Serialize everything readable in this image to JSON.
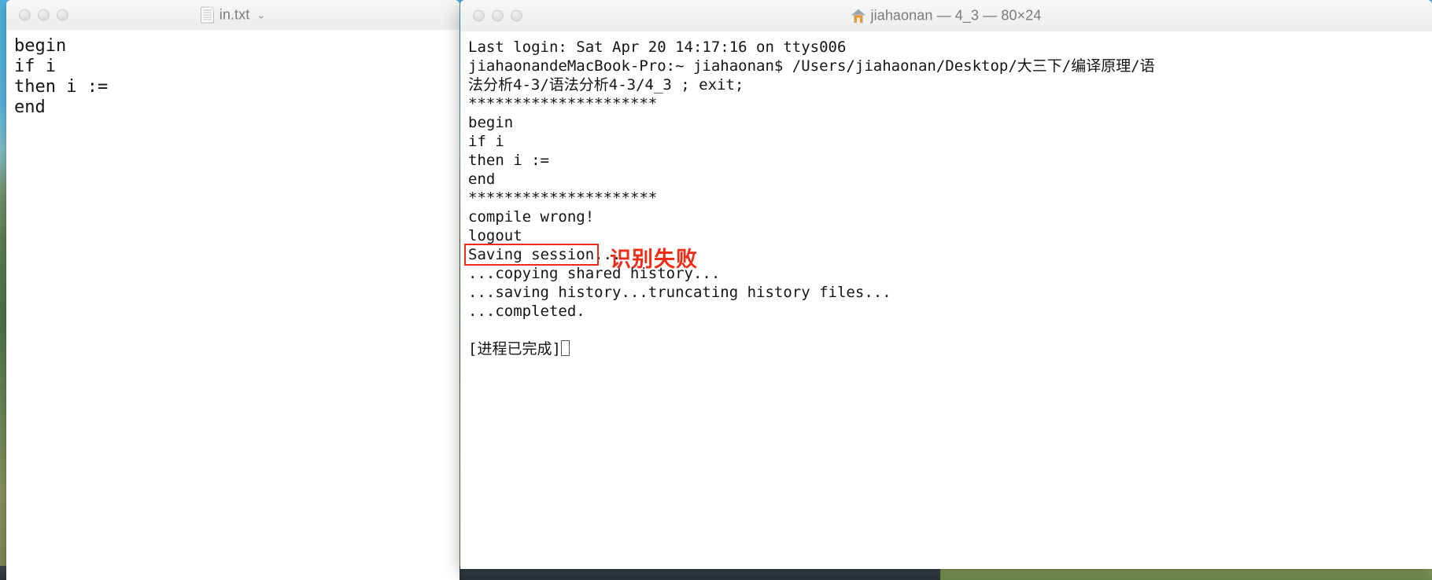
{
  "desktop": {
    "wallpaper_top_color": "#4fb4e0",
    "wallpaper_bottom_color": "#7d8f55",
    "dock_strip_color": "#323b42"
  },
  "editor_window": {
    "title": "in.txt",
    "title_icon": "document-icon",
    "chevron": "⌄",
    "traffic_lights": [
      "close-button",
      "minimize-button",
      "zoom-button"
    ],
    "content_lines": [
      "begin",
      "if i",
      "then i :=",
      "end"
    ]
  },
  "terminal_window": {
    "title": "jiahaonan — 4_3 — 80×24",
    "title_icon": "home-folder-icon",
    "traffic_lights": [
      "close-button",
      "minimize-button",
      "zoom-button"
    ],
    "content_lines": [
      "Last login: Sat Apr 20 14:17:16 on ttys006",
      "jiahaonandeMacBook-Pro:~ jiahaonan$ /Users/jiahaonan/Desktop/大三下/编译原理/语",
      "法分析4-3/语法分析4-3/4_3 ; exit;",
      "*********************",
      "begin",
      "if i",
      "then i :=",
      "end",
      "*********************",
      "compile wrong!",
      "logout",
      "Saving session...",
      "...copying shared history...",
      "...saving history...truncating history files...",
      "...completed.",
      "",
      "[进程已完成]"
    ],
    "cursor": "block-cursor"
  },
  "annotation": {
    "highlight_target": "compile wrong!",
    "note_text": "识别失败",
    "color": "#ef2d16"
  }
}
